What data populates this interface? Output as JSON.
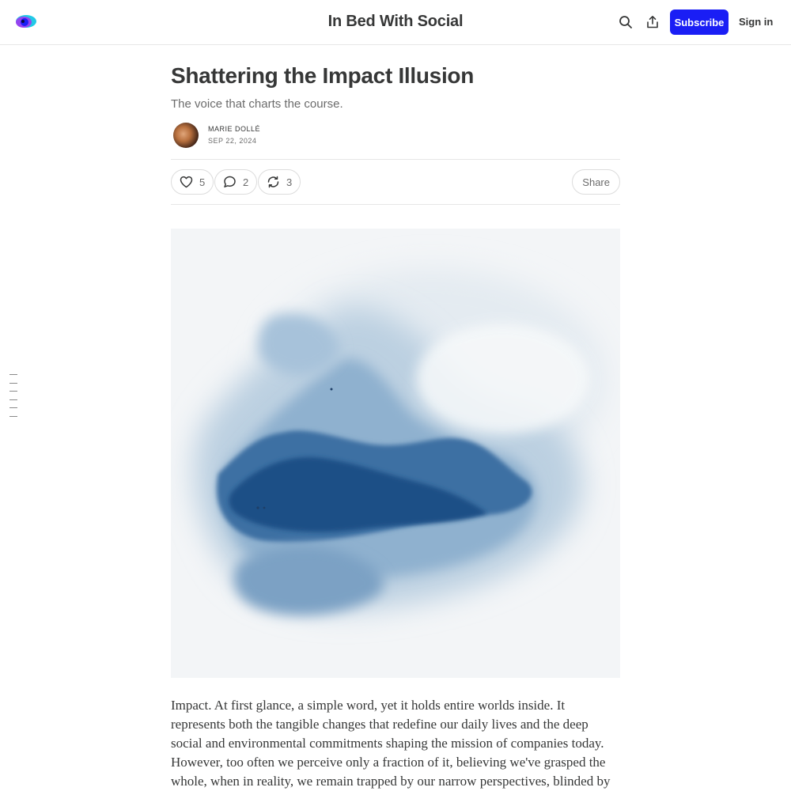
{
  "header": {
    "publication_title": "In Bed With Social",
    "subscribe_label": "Subscribe",
    "signin_label": "Sign in",
    "accent_color": "#1a1ef5",
    "icons": [
      "logo-icon",
      "search-icon",
      "share-icon"
    ]
  },
  "post": {
    "title": "Shattering the Impact Illusion",
    "subtitle": "The voice that charts the course.",
    "author": "MARIE DOLLÉ",
    "date": "SEP 22, 2024",
    "likes": "5",
    "comments": "2",
    "restacks": "3",
    "share_label": "Share",
    "body": "Impact. At first glance, a simple word, yet it holds entire worlds inside. It represents both the tangible changes that redefine our daily lives and the deep social and environmental commitments shaping the mission of companies today. However, too often we perceive only a fraction of it, believing we've grasped the whole, when in reality, we remain trapped by our narrow perspectives, blinded by limitations we no"
  },
  "toc": {
    "item_count": 6
  }
}
